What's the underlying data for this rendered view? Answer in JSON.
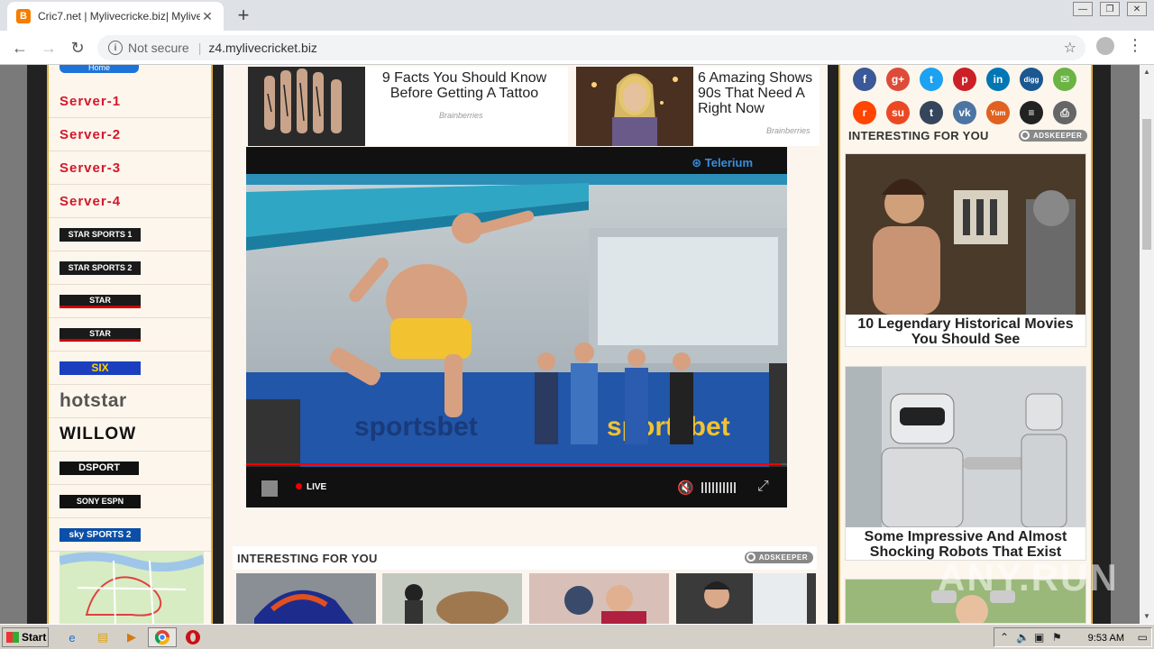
{
  "browser": {
    "tab_title": "Cric7.net | Mylivecricke.biz| Mylivecr",
    "tab_favicon": "B",
    "security_label": "Not secure",
    "url": "z4.mylivecricket.biz"
  },
  "left_nav": {
    "home_label": "Home",
    "servers": [
      "Server-1",
      "Server-2",
      "Server-3",
      "Server-4"
    ],
    "channels": [
      {
        "name": "star-sports-1",
        "label": "STAR SPORTS 1"
      },
      {
        "name": "star-sports-2",
        "label": "STAR SPORTS 2"
      },
      {
        "name": "star-channel-3",
        "label": "STAR"
      },
      {
        "name": "star-channel-4",
        "label": "STAR"
      },
      {
        "name": "six",
        "label": "SIX"
      },
      {
        "name": "hotstar",
        "label": "hotstar"
      },
      {
        "name": "willow",
        "label": "WILLOW"
      },
      {
        "name": "dsport",
        "label": "DSPORT"
      },
      {
        "name": "sony-espn",
        "label": "SONY  ESPN"
      },
      {
        "name": "sky-sports-2",
        "label": "sky SPORTS 2"
      }
    ]
  },
  "top_ads": [
    {
      "headline": "9 Facts You Should Know Before Getting A Tattoo",
      "source": "Brainberries"
    },
    {
      "headline": "6 Amazing Shows 90s That Need A Right Now",
      "source": "Brainberries"
    }
  ],
  "player": {
    "brand": "Telerium",
    "live_label": "LIVE",
    "progress": 0.99
  },
  "interesting": {
    "title": "INTERESTING FOR YOU",
    "provider": "ADSKEEPER"
  },
  "right_col": {
    "social_icons": [
      {
        "name": "facebook-icon",
        "glyph": "f",
        "color": "#3b5998"
      },
      {
        "name": "google-plus-icon",
        "glyph": "g+",
        "color": "#dd4b39"
      },
      {
        "name": "twitter-icon",
        "glyph": "t",
        "color": "#1da1f2"
      },
      {
        "name": "pinterest-icon",
        "glyph": "p",
        "color": "#cb2027"
      },
      {
        "name": "linkedin-icon",
        "glyph": "in",
        "color": "#0077b5"
      },
      {
        "name": "digg-icon",
        "glyph": "digg",
        "color": "#1b5791"
      },
      {
        "name": "email-icon",
        "glyph": "✉",
        "color": "#6ab344"
      },
      {
        "name": "reddit-icon",
        "glyph": "r",
        "color": "#ff4500"
      },
      {
        "name": "stumbleupon-icon",
        "glyph": "su",
        "color": "#eb4924"
      },
      {
        "name": "tumblr-icon",
        "glyph": "t",
        "color": "#35465c"
      },
      {
        "name": "vk-icon",
        "glyph": "vk",
        "color": "#4c75a3"
      },
      {
        "name": "yummly-icon",
        "glyph": "Yum",
        "color": "#e16120"
      },
      {
        "name": "buffer-icon",
        "glyph": "≡",
        "color": "#222"
      },
      {
        "name": "print-icon",
        "glyph": "⎙",
        "color": "#666"
      }
    ],
    "title": "INTERESTING FOR YOU",
    "provider": "ADSKEEPER",
    "cards": [
      {
        "caption": "10 Legendary Historical Movies You Should See"
      },
      {
        "caption": "Some Impressive And Almost Shocking Robots That Exist"
      }
    ]
  },
  "taskbar": {
    "start_label": "Start",
    "clock": "9:53 AM"
  }
}
